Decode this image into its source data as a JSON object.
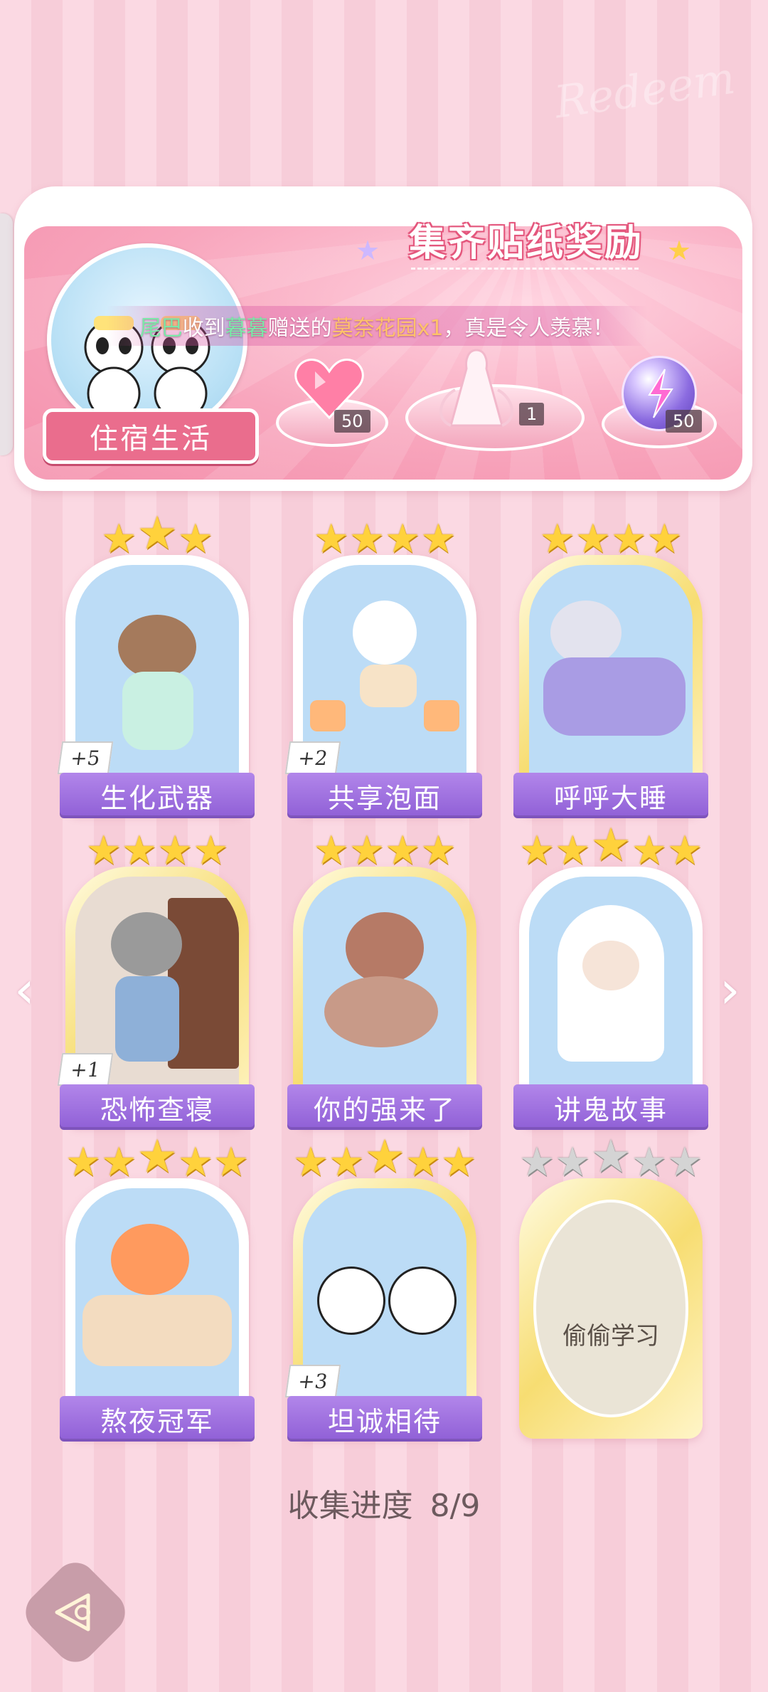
{
  "banner": {
    "title": "集齐贴纸奖励",
    "watermark": "Redeem",
    "dorm_label": "住宿生活",
    "ticker": {
      "sender": "尾巴",
      "text1": "收到",
      "receiver": "暮暮",
      "text2": "赠送的",
      "item": "莫奈花园x1",
      "text3": "，真是令人羡慕！"
    },
    "rewards": [
      {
        "icon": "pink-heart-gem-icon",
        "count": "50"
      },
      {
        "icon": "dress-outfit-icon",
        "count": "1"
      },
      {
        "icon": "purple-energy-orb-icon",
        "count": "50"
      }
    ]
  },
  "stickers": [
    {
      "name": "生化武器",
      "stars": 3,
      "plus": "+5",
      "frame": "white"
    },
    {
      "name": "共享泡面",
      "stars": 4,
      "plus": "+2",
      "frame": "white"
    },
    {
      "name": "呼呼大睡",
      "stars": 4,
      "plus": "",
      "frame": "gold"
    },
    {
      "name": "恐怖查寝",
      "stars": 4,
      "plus": "+1",
      "frame": "gold"
    },
    {
      "name": "你的强来了",
      "stars": 4,
      "plus": "",
      "frame": "gold"
    },
    {
      "name": "讲鬼故事",
      "stars": 5,
      "plus": "",
      "frame": "white"
    },
    {
      "name": "熬夜冠军",
      "stars": 5,
      "plus": "",
      "frame": "white"
    },
    {
      "name": "坦诚相待",
      "stars": 5,
      "plus": "+3",
      "frame": "gold"
    },
    {
      "name": "偷偷学习",
      "stars": 5,
      "plus": "",
      "frame": "gold",
      "locked": true
    }
  ],
  "progress": {
    "label": "收集进度",
    "value": "8/9"
  },
  "colors": {
    "accent": "#ea6d8d",
    "label_purple": "#9b6be0",
    "star_gold": "#ffd23c"
  }
}
